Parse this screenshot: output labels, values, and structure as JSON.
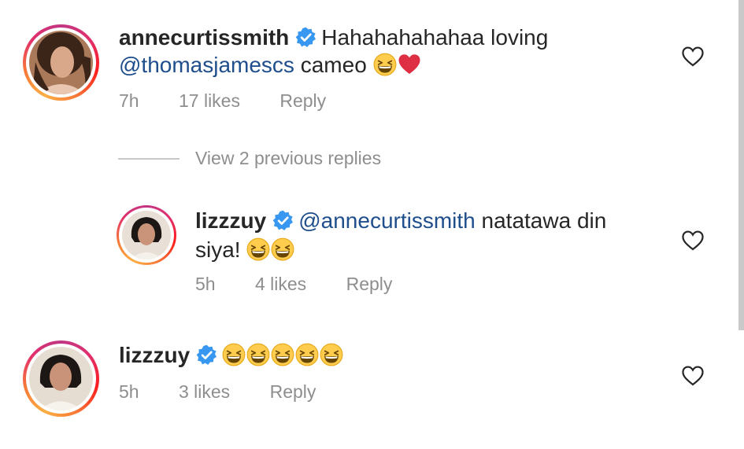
{
  "comments": [
    {
      "username": "annecurtissmith",
      "text_before": "Hahahahahahaa loving",
      "mention": "@thomasjamescs",
      "text_after": "cameo",
      "time": "7h",
      "likes": "17 likes",
      "reply": "Reply"
    },
    {
      "username": "lizzzuy",
      "mention": "@annecurtissmith",
      "text_after": "natatawa din",
      "text_line2": "siya!",
      "time": "5h",
      "likes": "4 likes",
      "reply": "Reply"
    },
    {
      "username": "lizzzuy",
      "time": "5h",
      "likes": "3 likes",
      "reply": "Reply"
    }
  ],
  "view_replies": "View 2 previous replies",
  "icons": {
    "verified": "verified-badge-icon",
    "heart": "heart-outline-icon",
    "emoji_laugh": "grinning-squinting-face-emoji",
    "emoji_heart": "red-heart-emoji"
  },
  "colors": {
    "verified_blue": "#3897f0",
    "mention": "#1f4e8c",
    "meta": "#8e8e8e"
  }
}
